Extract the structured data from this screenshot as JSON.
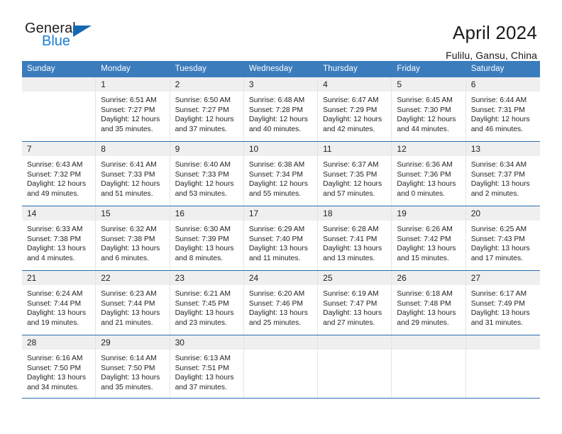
{
  "brand": {
    "name_top": "General",
    "name_bottom": "Blue",
    "accent_color": "#1b7fd4",
    "triangle_color": "#1267b1"
  },
  "header": {
    "title": "April 2024",
    "location": "Fulilu, Gansu, China"
  },
  "theme": {
    "header_bar_color": "#3b7cbd",
    "row_divider_color": "#2a6cb0",
    "day_number_band_color": "#efefef"
  },
  "weekdays": [
    "Sunday",
    "Monday",
    "Tuesday",
    "Wednesday",
    "Thursday",
    "Friday",
    "Saturday"
  ],
  "weeks": [
    [
      {
        "day": "",
        "empty": true
      },
      {
        "day": "1",
        "sunrise": "Sunrise: 6:51 AM",
        "sunset": "Sunset: 7:27 PM",
        "daylight_line1": "Daylight: 12 hours",
        "daylight_line2": "and 35 minutes."
      },
      {
        "day": "2",
        "sunrise": "Sunrise: 6:50 AM",
        "sunset": "Sunset: 7:27 PM",
        "daylight_line1": "Daylight: 12 hours",
        "daylight_line2": "and 37 minutes."
      },
      {
        "day": "3",
        "sunrise": "Sunrise: 6:48 AM",
        "sunset": "Sunset: 7:28 PM",
        "daylight_line1": "Daylight: 12 hours",
        "daylight_line2": "and 40 minutes."
      },
      {
        "day": "4",
        "sunrise": "Sunrise: 6:47 AM",
        "sunset": "Sunset: 7:29 PM",
        "daylight_line1": "Daylight: 12 hours",
        "daylight_line2": "and 42 minutes."
      },
      {
        "day": "5",
        "sunrise": "Sunrise: 6:45 AM",
        "sunset": "Sunset: 7:30 PM",
        "daylight_line1": "Daylight: 12 hours",
        "daylight_line2": "and 44 minutes."
      },
      {
        "day": "6",
        "sunrise": "Sunrise: 6:44 AM",
        "sunset": "Sunset: 7:31 PM",
        "daylight_line1": "Daylight: 12 hours",
        "daylight_line2": "and 46 minutes."
      }
    ],
    [
      {
        "day": "7",
        "sunrise": "Sunrise: 6:43 AM",
        "sunset": "Sunset: 7:32 PM",
        "daylight_line1": "Daylight: 12 hours",
        "daylight_line2": "and 49 minutes."
      },
      {
        "day": "8",
        "sunrise": "Sunrise: 6:41 AM",
        "sunset": "Sunset: 7:33 PM",
        "daylight_line1": "Daylight: 12 hours",
        "daylight_line2": "and 51 minutes."
      },
      {
        "day": "9",
        "sunrise": "Sunrise: 6:40 AM",
        "sunset": "Sunset: 7:33 PM",
        "daylight_line1": "Daylight: 12 hours",
        "daylight_line2": "and 53 minutes."
      },
      {
        "day": "10",
        "sunrise": "Sunrise: 6:38 AM",
        "sunset": "Sunset: 7:34 PM",
        "daylight_line1": "Daylight: 12 hours",
        "daylight_line2": "and 55 minutes."
      },
      {
        "day": "11",
        "sunrise": "Sunrise: 6:37 AM",
        "sunset": "Sunset: 7:35 PM",
        "daylight_line1": "Daylight: 12 hours",
        "daylight_line2": "and 57 minutes."
      },
      {
        "day": "12",
        "sunrise": "Sunrise: 6:36 AM",
        "sunset": "Sunset: 7:36 PM",
        "daylight_line1": "Daylight: 13 hours",
        "daylight_line2": "and 0 minutes."
      },
      {
        "day": "13",
        "sunrise": "Sunrise: 6:34 AM",
        "sunset": "Sunset: 7:37 PM",
        "daylight_line1": "Daylight: 13 hours",
        "daylight_line2": "and 2 minutes."
      }
    ],
    [
      {
        "day": "14",
        "sunrise": "Sunrise: 6:33 AM",
        "sunset": "Sunset: 7:38 PM",
        "daylight_line1": "Daylight: 13 hours",
        "daylight_line2": "and 4 minutes."
      },
      {
        "day": "15",
        "sunrise": "Sunrise: 6:32 AM",
        "sunset": "Sunset: 7:38 PM",
        "daylight_line1": "Daylight: 13 hours",
        "daylight_line2": "and 6 minutes."
      },
      {
        "day": "16",
        "sunrise": "Sunrise: 6:30 AM",
        "sunset": "Sunset: 7:39 PM",
        "daylight_line1": "Daylight: 13 hours",
        "daylight_line2": "and 8 minutes."
      },
      {
        "day": "17",
        "sunrise": "Sunrise: 6:29 AM",
        "sunset": "Sunset: 7:40 PM",
        "daylight_line1": "Daylight: 13 hours",
        "daylight_line2": "and 11 minutes."
      },
      {
        "day": "18",
        "sunrise": "Sunrise: 6:28 AM",
        "sunset": "Sunset: 7:41 PM",
        "daylight_line1": "Daylight: 13 hours",
        "daylight_line2": "and 13 minutes."
      },
      {
        "day": "19",
        "sunrise": "Sunrise: 6:26 AM",
        "sunset": "Sunset: 7:42 PM",
        "daylight_line1": "Daylight: 13 hours",
        "daylight_line2": "and 15 minutes."
      },
      {
        "day": "20",
        "sunrise": "Sunrise: 6:25 AM",
        "sunset": "Sunset: 7:43 PM",
        "daylight_line1": "Daylight: 13 hours",
        "daylight_line2": "and 17 minutes."
      }
    ],
    [
      {
        "day": "21",
        "sunrise": "Sunrise: 6:24 AM",
        "sunset": "Sunset: 7:44 PM",
        "daylight_line1": "Daylight: 13 hours",
        "daylight_line2": "and 19 minutes."
      },
      {
        "day": "22",
        "sunrise": "Sunrise: 6:23 AM",
        "sunset": "Sunset: 7:44 PM",
        "daylight_line1": "Daylight: 13 hours",
        "daylight_line2": "and 21 minutes."
      },
      {
        "day": "23",
        "sunrise": "Sunrise: 6:21 AM",
        "sunset": "Sunset: 7:45 PM",
        "daylight_line1": "Daylight: 13 hours",
        "daylight_line2": "and 23 minutes."
      },
      {
        "day": "24",
        "sunrise": "Sunrise: 6:20 AM",
        "sunset": "Sunset: 7:46 PM",
        "daylight_line1": "Daylight: 13 hours",
        "daylight_line2": "and 25 minutes."
      },
      {
        "day": "25",
        "sunrise": "Sunrise: 6:19 AM",
        "sunset": "Sunset: 7:47 PM",
        "daylight_line1": "Daylight: 13 hours",
        "daylight_line2": "and 27 minutes."
      },
      {
        "day": "26",
        "sunrise": "Sunrise: 6:18 AM",
        "sunset": "Sunset: 7:48 PM",
        "daylight_line1": "Daylight: 13 hours",
        "daylight_line2": "and 29 minutes."
      },
      {
        "day": "27",
        "sunrise": "Sunrise: 6:17 AM",
        "sunset": "Sunset: 7:49 PM",
        "daylight_line1": "Daylight: 13 hours",
        "daylight_line2": "and 31 minutes."
      }
    ],
    [
      {
        "day": "28",
        "sunrise": "Sunrise: 6:16 AM",
        "sunset": "Sunset: 7:50 PM",
        "daylight_line1": "Daylight: 13 hours",
        "daylight_line2": "and 34 minutes."
      },
      {
        "day": "29",
        "sunrise": "Sunrise: 6:14 AM",
        "sunset": "Sunset: 7:50 PM",
        "daylight_line1": "Daylight: 13 hours",
        "daylight_line2": "and 35 minutes."
      },
      {
        "day": "30",
        "sunrise": "Sunrise: 6:13 AM",
        "sunset": "Sunset: 7:51 PM",
        "daylight_line1": "Daylight: 13 hours",
        "daylight_line2": "and 37 minutes."
      },
      {
        "day": "",
        "empty": true
      },
      {
        "day": "",
        "empty": true
      },
      {
        "day": "",
        "empty": true
      },
      {
        "day": "",
        "empty": true
      }
    ]
  ]
}
